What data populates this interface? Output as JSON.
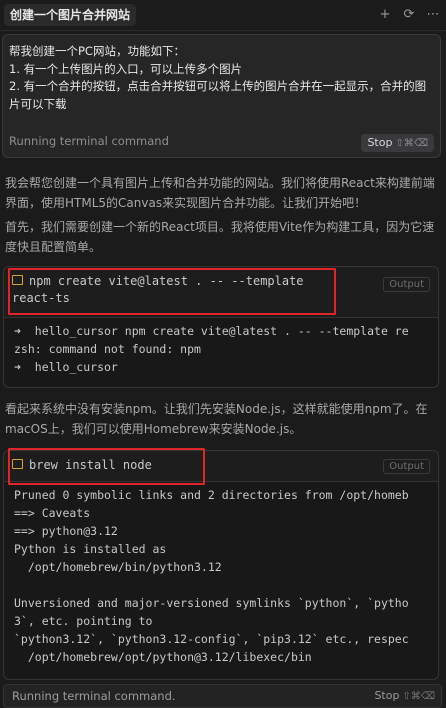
{
  "header": {
    "title": "创建一个图片合并网站",
    "icons": [
      "plus-icon",
      "history-icon",
      "more-icon"
    ],
    "plus_glyph": "+",
    "history_glyph": "⟳",
    "more_glyph": "⋯"
  },
  "prompt": {
    "text": "帮我创建一个PC网站，功能如下：\n1. 有一个上传图片的入口，可以上传多个图片\n2. 有一个合并的按钮，点击合并按钮可以将上传的图片合并在一起显示，合并的图片可以下载",
    "status": "Running terminal command",
    "stop_label": "Stop",
    "stop_shortcut": "⇧⌘⌫"
  },
  "messages": [
    "我会帮您创建一个具有图片上传和合并功能的网站。我们将使用React来构建前端界面，使用HTML5的Canvas来实现图片合并功能。让我们开始吧！",
    "首先，我们需要创建一个新的React项目。我将使用Vite作为构建工具，因为它速度快且配置简单。",
    "看起来系统中没有安装npm。让我们先安装Node.js，这样就能使用npm了。在macOS上，我们可以使用Homebrew来安装Node.js。"
  ],
  "terminals": [
    {
      "command": "npm create vite@latest . -- --template\nreact-ts",
      "output_label": "Output",
      "output": "➜  hello_cursor npm create vite@latest . -- --template re\nzsh: command not found: npm\n➜  hello_cursor"
    },
    {
      "command": "brew install node",
      "output_label": "Output",
      "output": "Pruned 0 symbolic links and 2 directories from /opt/homeb\n==> Caveats\n==> python@3.12\nPython is installed as\n  /opt/homebrew/bin/python3.12\n\nUnversioned and major-versioned symlinks `python`, `pytho\n3`, etc. pointing to\n`python3.12`, `python3.12-config`, `pip3.12` etc., respec\n  /opt/homebrew/opt/python@3.12/libexec/bin"
    }
  ],
  "footer": {
    "status": "Running terminal command.",
    "stop_label": "Stop",
    "stop_shortcut": "⇧⌘⌫"
  },
  "colors": {
    "highlight_box": "#e0252a",
    "terminal_icon": "#d9a33b",
    "background": "#1b1b1c"
  }
}
